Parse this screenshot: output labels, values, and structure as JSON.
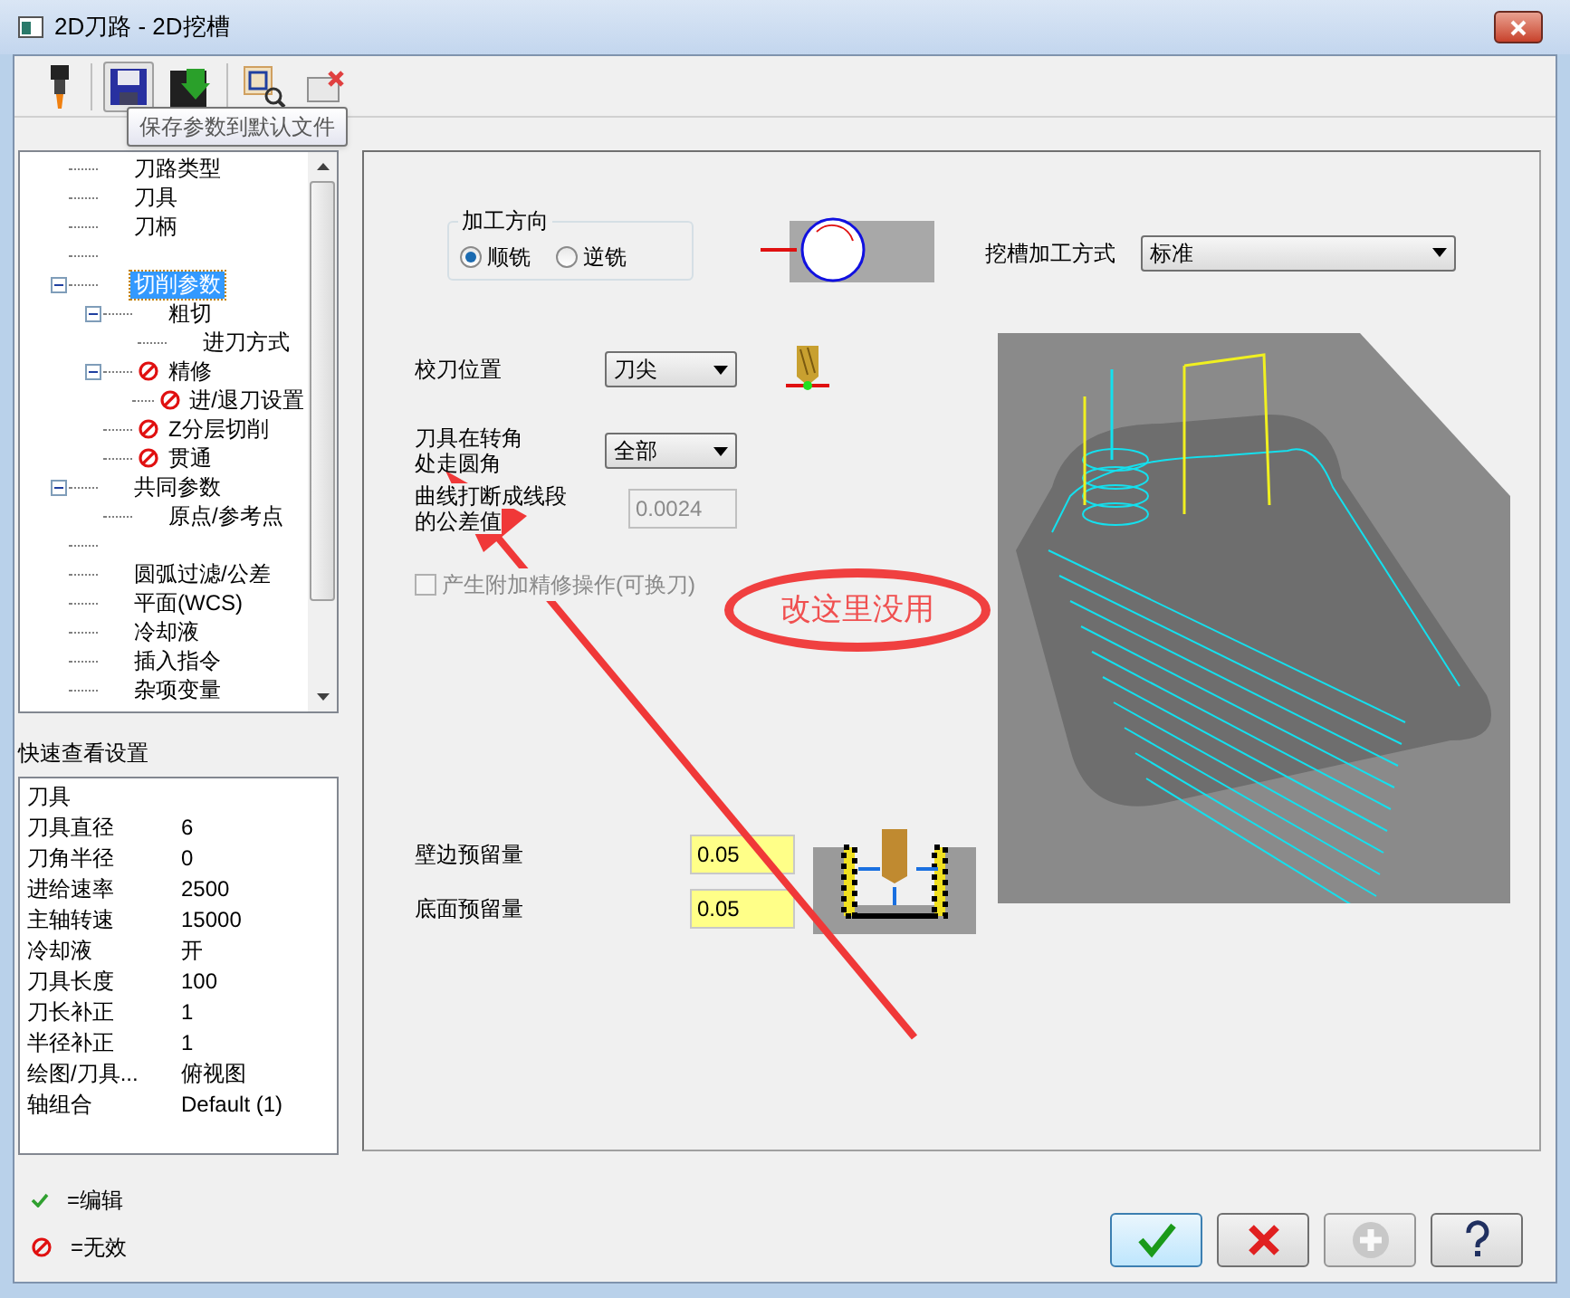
{
  "window": {
    "title": "2D刀路 - 2D挖槽"
  },
  "toolbar": {
    "tooltip": "保存参数到默认文件"
  },
  "tree": [
    {
      "kind": "item",
      "label": "刀路类型",
      "selected": false
    },
    {
      "kind": "item",
      "label": "刀具",
      "selected": false
    },
    {
      "kind": "item",
      "label": "刀柄",
      "selected": false
    },
    {
      "kind": "blank"
    },
    {
      "kind": "item",
      "label": "切削参数",
      "selected": true,
      "expanded": true,
      "children": [
        {
          "kind": "item",
          "label": "粗切",
          "selected": false,
          "expanded": true,
          "children": [
            {
              "kind": "item",
              "label": "进刀方式",
              "selected": false
            }
          ]
        },
        {
          "kind": "item",
          "label": "精修",
          "selected": false,
          "invalid": true,
          "expanded": true,
          "children": [
            {
              "kind": "item",
              "label": "进/退刀设置",
              "selected": false,
              "invalid": true
            }
          ]
        },
        {
          "kind": "item",
          "label": "Z分层切削",
          "selected": false,
          "invalid": true
        },
        {
          "kind": "item",
          "label": "贯通",
          "selected": false,
          "invalid": true
        }
      ]
    },
    {
      "kind": "item",
      "label": "共同参数",
      "selected": false,
      "expanded": true,
      "children": [
        {
          "kind": "item",
          "label": "原点/参考点",
          "selected": false
        }
      ]
    },
    {
      "kind": "blank"
    },
    {
      "kind": "item",
      "label": "圆弧过滤/公差",
      "selected": false
    },
    {
      "kind": "item",
      "label": "平面(WCS)",
      "selected": false
    },
    {
      "kind": "item",
      "label": "冷却液",
      "selected": false
    },
    {
      "kind": "item",
      "label": "插入指令",
      "selected": false
    },
    {
      "kind": "item",
      "label": "杂项变量",
      "selected": false
    }
  ],
  "quick_view": {
    "title": "快速查看设置",
    "rows": [
      {
        "label": "刀具"
      },
      {
        "label": "刀具直径",
        "value": "6"
      },
      {
        "label": "刀角半径",
        "value": "0"
      },
      {
        "label": "进给速率",
        "value": "2500"
      },
      {
        "label": "主轴转速",
        "value": "15000"
      },
      {
        "label": "冷却液",
        "value": "开"
      },
      {
        "label": "刀具长度",
        "value": "100"
      },
      {
        "label": "刀长补正",
        "value": "1"
      },
      {
        "label": "半径补正",
        "value": "1"
      },
      {
        "label": "绘图/刀具...",
        "value": "俯视图"
      },
      {
        "label": "轴组合",
        "value": "Default (1)"
      }
    ]
  },
  "legend": [
    {
      "kind": "edit",
      "label": "=编辑"
    },
    {
      "kind": "invalid",
      "label": "=无效"
    }
  ],
  "cut_direction": {
    "title": "加工方向",
    "options": [
      {
        "label": "顺铣",
        "selected": true
      },
      {
        "label": "逆铣",
        "selected": false
      }
    ]
  },
  "pocket_type": {
    "label": "挖槽加工方式",
    "value": "标准"
  },
  "tool_position": {
    "label": "校刀位置",
    "value": "刀尖"
  },
  "corner_rounding": {
    "lines": [
      "刀具在转角",
      "处走圆角"
    ],
    "value": "全部"
  },
  "tolerance": {
    "lines": [
      "曲线打断成线段",
      "的公差值"
    ],
    "value": "0.0024",
    "disabled": true
  },
  "extra_finish": {
    "label": "产生附加精修操作(可换刀)",
    "checked": false,
    "disabled": true
  },
  "stock": [
    {
      "label": "壁边预留量",
      "value": "0.05"
    },
    {
      "label": "底面预留量",
      "value": "0.05"
    }
  ],
  "annotation": {
    "text": "改这里没用"
  },
  "buttons": [
    {
      "kind": "ok",
      "disabled": false
    },
    {
      "kind": "cancel",
      "disabled": false
    },
    {
      "kind": "add",
      "disabled": true
    },
    {
      "kind": "help",
      "disabled": false
    }
  ]
}
